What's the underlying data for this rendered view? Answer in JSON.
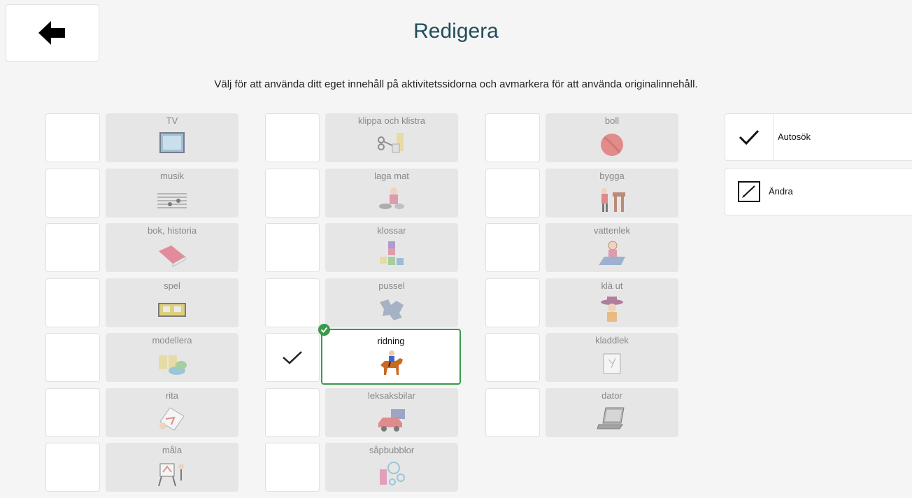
{
  "header": {
    "back_icon": "arrow-left-icon",
    "title": "Redigera",
    "subtitle": "Välj för att använda ditt eget innehåll på aktivitetssidorna och avmarkera för att använda originalinnehåll."
  },
  "columns": [
    {
      "items": [
        {
          "label": "TV",
          "icon": "tv-icon",
          "checked": false
        },
        {
          "label": "musik",
          "icon": "music-icon",
          "checked": false
        },
        {
          "label": "bok, historia",
          "icon": "book-icon",
          "checked": false
        },
        {
          "label": "spel",
          "icon": "game-icon",
          "checked": false
        },
        {
          "label": "modellera",
          "icon": "clay-icon",
          "checked": false
        },
        {
          "label": "rita",
          "icon": "draw-icon",
          "checked": false
        },
        {
          "label": "måla",
          "icon": "easel-icon",
          "checked": false
        }
      ]
    },
    {
      "items": [
        {
          "label": "klippa och klistra",
          "icon": "scissors-glue-icon",
          "checked": false
        },
        {
          "label": "laga mat",
          "icon": "cooking-icon",
          "checked": false
        },
        {
          "label": "klossar",
          "icon": "blocks-icon",
          "checked": false
        },
        {
          "label": "pussel",
          "icon": "puzzle-icon",
          "checked": false
        },
        {
          "label": "ridning",
          "icon": "horse-riding-icon",
          "checked": true
        },
        {
          "label": "leksaksbilar",
          "icon": "toy-car-icon",
          "checked": false
        },
        {
          "label": "såpbubblor",
          "icon": "bubbles-icon",
          "checked": false
        }
      ]
    },
    {
      "items": [
        {
          "label": "boll",
          "icon": "ball-icon",
          "checked": false
        },
        {
          "label": "bygga",
          "icon": "build-icon",
          "checked": false
        },
        {
          "label": "vattenlek",
          "icon": "water-play-icon",
          "checked": false
        },
        {
          "label": "klä ut",
          "icon": "dress-up-icon",
          "checked": false
        },
        {
          "label": "kladdlek",
          "icon": "messy-play-icon",
          "checked": false
        },
        {
          "label": "dator",
          "icon": "laptop-icon",
          "checked": false
        }
      ]
    }
  ],
  "options": {
    "autosearch": {
      "label": "Autosök",
      "icon": "check-icon",
      "checked": true
    },
    "edit": {
      "label": "Ändra",
      "icon": "pencil-box-icon"
    }
  },
  "colors": {
    "title": "#1f4e5a",
    "selected_border": "#3a9a4a",
    "tile_bg": "#e6e6e6"
  }
}
